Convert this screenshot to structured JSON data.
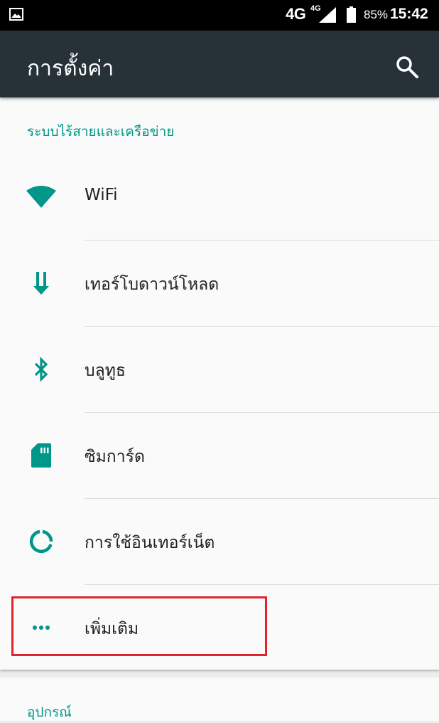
{
  "status_bar": {
    "network": "4G",
    "network_sup": "4G",
    "battery": "85%",
    "time": "15:42"
  },
  "toolbar": {
    "title": "การตั้งค่า",
    "search_icon": "search-icon"
  },
  "sections": [
    {
      "header": "ระบบไร้สายและเครือข่าย",
      "items": [
        {
          "label": "WiFi",
          "icon": "wifi-icon"
        },
        {
          "label": "เทอร์โบดาวน์โหลด",
          "icon": "download-arrow-icon"
        },
        {
          "label": "บลูทูธ",
          "icon": "bluetooth-icon"
        },
        {
          "label": "ซิมการ์ด",
          "icon": "sim-card-icon"
        },
        {
          "label": "การใช้อินเทอร์เน็ต",
          "icon": "data-usage-icon"
        },
        {
          "label": "เพิ่มเติม",
          "icon": "more-dots-icon"
        }
      ]
    },
    {
      "header": "อุปกรณ์",
      "items": []
    }
  ],
  "colors": {
    "accent": "#009688",
    "toolbar": "#263238",
    "highlight": "#e0242c"
  }
}
